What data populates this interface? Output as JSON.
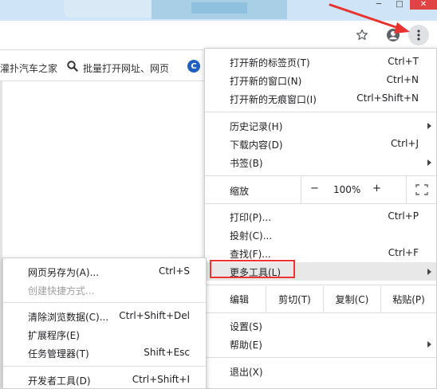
{
  "window_controls": {
    "minimize": "─",
    "maximize": "□",
    "close": "✕"
  },
  "toolbar": {
    "star_icon": "star-icon",
    "profile_icon": "profile-icon",
    "menu_icon": "kebab-menu-icon"
  },
  "bookmarks": [
    {
      "label": "灌扑汽车之家"
    },
    {
      "label": "批量打开网址、网页"
    }
  ],
  "menu": {
    "new_tab": {
      "label": "打开新的标签页(T)",
      "shortcut": "Ctrl+T"
    },
    "new_window": {
      "label": "打开新的窗口(N)",
      "shortcut": "Ctrl+N"
    },
    "incognito": {
      "label": "打开新的无痕窗口(I)",
      "shortcut": "Ctrl+Shift+N"
    },
    "history": {
      "label": "历史记录(H)"
    },
    "downloads": {
      "label": "下载内容(D)",
      "shortcut": "Ctrl+J"
    },
    "bookmarks": {
      "label": "书签(B)"
    },
    "zoom": {
      "label": "缩放",
      "minus": "−",
      "value": "100%",
      "plus": "+"
    },
    "print": {
      "label": "打印(P)...",
      "shortcut": "Ctrl+P"
    },
    "cast": {
      "label": "投射(C)..."
    },
    "find": {
      "label": "查找(F)...",
      "shortcut": "Ctrl+F"
    },
    "more_tools": {
      "label": "更多工具(L)"
    },
    "edit": {
      "label": "编辑",
      "cut": "剪切(T)",
      "copy": "复制(C)",
      "paste": "粘贴(P)"
    },
    "settings": {
      "label": "设置(S)"
    },
    "help": {
      "label": "帮助(E)"
    },
    "exit": {
      "label": "退出(X)"
    }
  },
  "submenu": {
    "save_page": {
      "label": "网页另存为(A)...",
      "shortcut": "Ctrl+S"
    },
    "create_shortcut": {
      "label": "创建快捷方式..."
    },
    "clear_data": {
      "label": "清除浏览数据(C)...",
      "shortcut": "Ctrl+Shift+Del"
    },
    "extensions": {
      "label": "扩展程序(E)"
    },
    "task_manager": {
      "label": "任务管理器(T)",
      "shortcut": "Shift+Esc"
    },
    "dev_tools": {
      "label": "开发者工具(D)",
      "shortcut": "Ctrl+Shift+I"
    }
  },
  "colors": {
    "highlight_box": "#ee3333",
    "arrow": "#e8322f"
  }
}
